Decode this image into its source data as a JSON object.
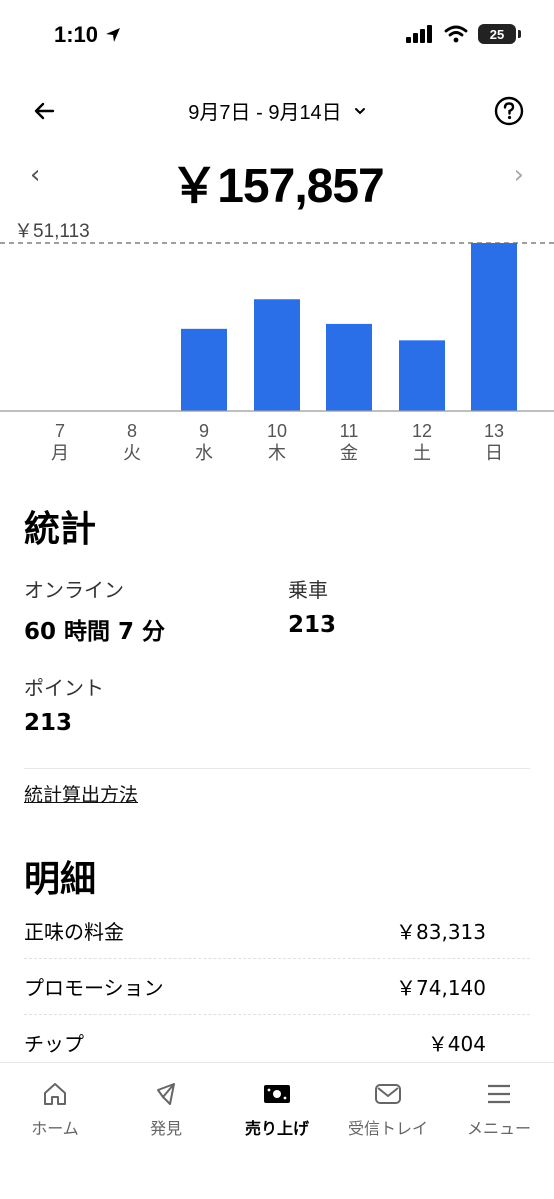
{
  "status_bar": {
    "time": "1:10",
    "battery": "25"
  },
  "header": {
    "date_range": "9月7日 - 9月14日"
  },
  "total": {
    "amount": "￥157,857",
    "prev_arrow": "‹",
    "next_arrow": "›"
  },
  "chart_data": {
    "type": "bar",
    "max_label": "￥51,113",
    "categories": [
      {
        "day": "7",
        "weekday": "月"
      },
      {
        "day": "8",
        "weekday": "火"
      },
      {
        "day": "9",
        "weekday": "水"
      },
      {
        "day": "10",
        "weekday": "木"
      },
      {
        "day": "11",
        "weekday": "金"
      },
      {
        "day": "12",
        "weekday": "土"
      },
      {
        "day": "13",
        "weekday": "日"
      }
    ],
    "values": [
      0,
      0,
      25000,
      34000,
      26500,
      21500,
      51113
    ],
    "ylim": [
      0,
      51113
    ],
    "bar_color": "#2a6fe8"
  },
  "stats": {
    "title": "統計",
    "online_label": "オンライン",
    "online_value": "60 時間 7 分",
    "rides_label": "乗車",
    "rides_value": "213",
    "points_label": "ポイント",
    "points_value": "213",
    "link": "統計算出方法"
  },
  "details": {
    "title": "明細",
    "rows": [
      {
        "label": "正味の料金",
        "value": "￥83,313"
      },
      {
        "label": "プロモーション",
        "value": "￥74,140"
      },
      {
        "label": "チップ",
        "value": "￥404"
      }
    ]
  },
  "nav": {
    "items": [
      {
        "label": "ホーム",
        "icon": "home-icon"
      },
      {
        "label": "発見",
        "icon": "compass-icon"
      },
      {
        "label": "売り上げ",
        "icon": "cash-icon"
      },
      {
        "label": "受信トレイ",
        "icon": "mail-icon"
      },
      {
        "label": "メニュー",
        "icon": "menu-icon"
      }
    ],
    "active_index": 2
  }
}
